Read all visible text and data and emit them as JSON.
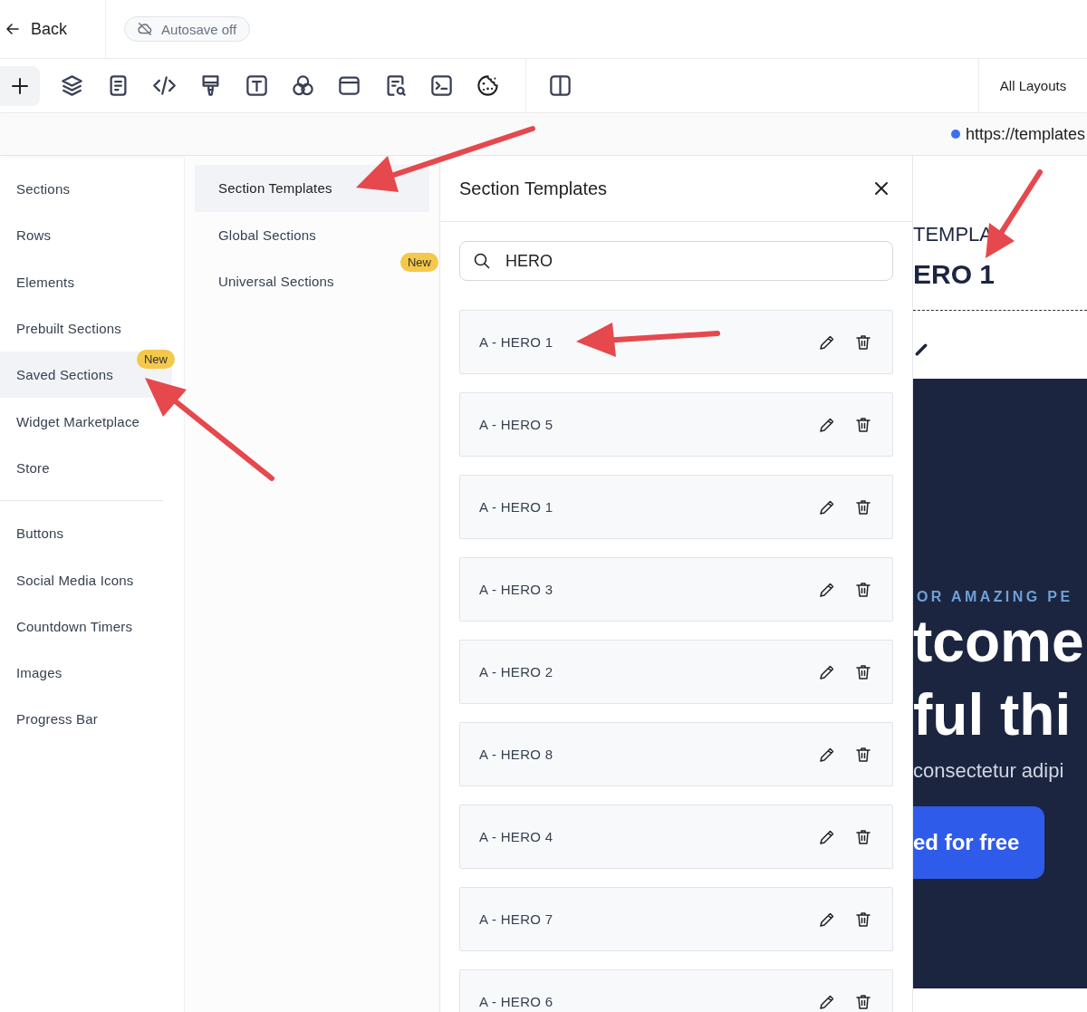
{
  "top_bar": {
    "back": "Back",
    "autosave": "Autosave off"
  },
  "toolbar": {
    "layouts": "All Layouts"
  },
  "url_bar": {
    "url": "https://templates"
  },
  "nav": {
    "groups": [
      [
        {
          "label": "Sections",
          "selected": false
        },
        {
          "label": "Rows",
          "selected": false
        },
        {
          "label": "Elements",
          "selected": false
        },
        {
          "label": "Prebuilt Sections",
          "selected": false
        },
        {
          "label": "Saved Sections",
          "selected": true,
          "badge": "New"
        },
        {
          "label": "Widget Marketplace",
          "selected": false
        },
        {
          "label": "Store",
          "selected": false
        }
      ],
      [
        {
          "label": "Buttons",
          "selected": false
        },
        {
          "label": "Social Media Icons",
          "selected": false
        },
        {
          "label": "Countdown Timers",
          "selected": false
        },
        {
          "label": "Images",
          "selected": false
        },
        {
          "label": "Progress Bar",
          "selected": false
        }
      ]
    ]
  },
  "sub_nav": [
    {
      "label": "Section Templates",
      "selected": true
    },
    {
      "label": "Global Sections",
      "selected": false
    },
    {
      "label": "Universal Sections",
      "selected": false,
      "badge": "New"
    }
  ],
  "panel": {
    "title": "Section Templates",
    "search": {
      "value": "HERO"
    },
    "templates": [
      {
        "name": "A - HERO 1"
      },
      {
        "name": "A - HERO 5"
      },
      {
        "name": "A - HERO 1"
      },
      {
        "name": "A - HERO 3"
      },
      {
        "name": "A - HERO 2"
      },
      {
        "name": "A - HERO 8"
      },
      {
        "name": "A - HERO 4"
      },
      {
        "name": "A - HERO 7"
      },
      {
        "name": "A - HERO 6"
      }
    ]
  },
  "preview": {
    "label": "TEMPLA",
    "title": "ERO 1",
    "eyebrow": "OR AMAZING PE",
    "headline": [
      "tcome",
      "ful thi"
    ],
    "body": "consectetur adipi",
    "cta": "ed for free"
  }
}
